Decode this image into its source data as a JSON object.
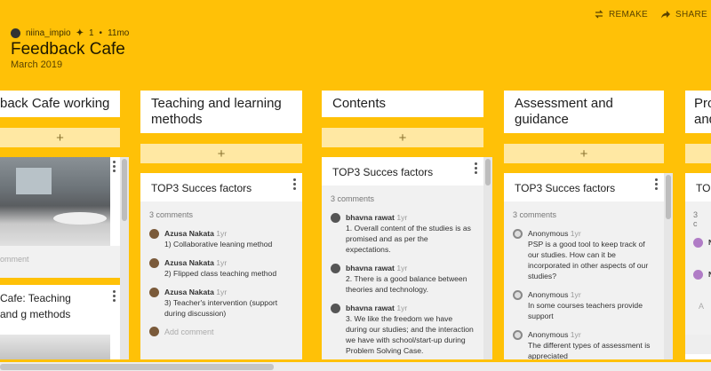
{
  "header": {
    "remake_label": "REMAKE",
    "share_label": "SHARE",
    "author": "niina_impio",
    "likes": "1",
    "age": "11mo",
    "title": "Feedback Cafe",
    "date": "March 2019"
  },
  "columns": [
    {
      "title": "back Cafe working"
    },
    {
      "title": "Teaching and learning methods"
    },
    {
      "title": "Contents"
    },
    {
      "title": "Assessment and guidance"
    },
    {
      "title": "Pro and"
    }
  ],
  "add_symbol": "+",
  "col1": {
    "comment_placeholder": "omment",
    "card2_title": "Cafe: Teaching and g methods"
  },
  "col2": {
    "card_title": "TOP3 Succes factors",
    "comment_count": "3 comments",
    "comments": [
      {
        "name": "Azusa Nakata",
        "time": "1yr",
        "text": "1) Collaborative leaning method"
      },
      {
        "name": "Azusa Nakata",
        "time": "1yr",
        "text": "2) Flipped class teaching method"
      },
      {
        "name": "Azusa Nakata",
        "time": "1yr",
        "text": "3) Teacher's intervention (support during discussion)"
      }
    ],
    "add_comment": "Add comment"
  },
  "col3": {
    "card_title": "TOP3 Succes factors",
    "comment_count": "3 comments",
    "comments": [
      {
        "name": "bhavna rawat",
        "time": "1yr",
        "text": "1. Overall content of the studies is as promised and as per the expectations."
      },
      {
        "name": "bhavna rawat",
        "time": "1yr",
        "text": "2. There is a good balance between theories and technology."
      },
      {
        "name": "bhavna rawat",
        "time": "1yr",
        "text": "3. We like the freedom we have during our studies; and the interaction we have with school/start-up during Problem Solving Case."
      }
    ]
  },
  "col4": {
    "card_title": "TOP3 Succes factors",
    "comment_count": "3 comments",
    "comments": [
      {
        "name": "Anonymous",
        "time": "1yr",
        "text": "PSP is a good tool to keep track of our studies. How can it be incorporated in other aspects of our studies?"
      },
      {
        "name": "Anonymous",
        "time": "1yr",
        "text": "In some courses teachers provide support"
      },
      {
        "name": "Anonymous",
        "time": "1yr",
        "text": "The different types of assessment is appreciated"
      }
    ]
  },
  "col5": {
    "card_title": "TOP",
    "comment_count": "3 c",
    "initials": [
      "N",
      "N"
    ],
    "placeholder": "A"
  },
  "colors": {
    "background": "#ffc107",
    "add_button": "#ffe8a3"
  }
}
